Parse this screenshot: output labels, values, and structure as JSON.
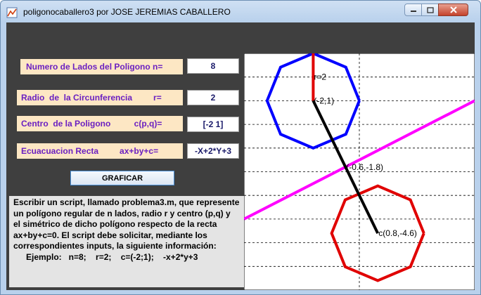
{
  "window": {
    "title": "poligonocaballero3  por JOSE JEREMIAS CABALLERO",
    "icon": "matlab-figure-icon"
  },
  "form": {
    "n_label": "Numero de Lados del Poligono n=",
    "n_value": "8",
    "r_label": "Radio  de  la Circunferencia         r=",
    "r_value": "2",
    "c_label": "Centro  de la Poligono          c(p,q)=",
    "c_value": "[-2 1]",
    "eq_label": "Ecuacuacion Recta         ax+by+c=",
    "eq_value": "-X+2*Y+3",
    "button_label": "GRAFICAR"
  },
  "description": {
    "text": "Escribir un script, llamado problema3.m, que represente un polígono regular de n lados, radio r y centro (p,q) y el simétrico de dicho polígono respecto de la recta ax+by+c=0. El script debe solicitar, mediante los correspondientes inputs, la siguiente información:",
    "example": "Ejemplo:   n=8;    r=2;    c=(-2;1);    -x+2*y+3"
  },
  "chart_data": {
    "type": "line",
    "xlim": [
      -5,
      5
    ],
    "ylim": [
      -7,
      3
    ],
    "xticks": [
      "-5",
      "0",
      "5"
    ],
    "yticks": [
      "3",
      "2",
      "1",
      "0",
      "-1",
      "-2",
      "-3",
      "-4",
      "-5",
      "-6"
    ],
    "grid": true,
    "series": [
      {
        "kind": "polygon",
        "center": [
          -2,
          1
        ],
        "radius": 2,
        "sides": 8,
        "color": "#0000ff"
      },
      {
        "kind": "polygon",
        "center": [
          0.8,
          -4.6
        ],
        "radius": 2,
        "sides": 8,
        "color": "#e00000"
      },
      {
        "kind": "line",
        "points": [
          [
            -5,
            -4
          ],
          [
            5,
            1
          ]
        ],
        "color": "#ff00ff"
      },
      {
        "kind": "line",
        "points": [
          [
            -2,
            1
          ],
          [
            -2,
            3
          ]
        ],
        "color": "#e00000"
      },
      {
        "kind": "line",
        "points": [
          [
            -2,
            1
          ],
          [
            0.8,
            -4.6
          ]
        ],
        "color": "#000000"
      }
    ],
    "annotations": [
      {
        "text": "r=2",
        "x": -2,
        "y": 2
      },
      {
        "text": "(-2,1)",
        "x": -2,
        "y": 1
      },
      {
        "text": "(-0.6,-1.8)",
        "x": -0.6,
        "y": -1.8
      },
      {
        "text": "c(0.8,-4.6)",
        "x": 0.8,
        "y": -4.6
      }
    ]
  }
}
